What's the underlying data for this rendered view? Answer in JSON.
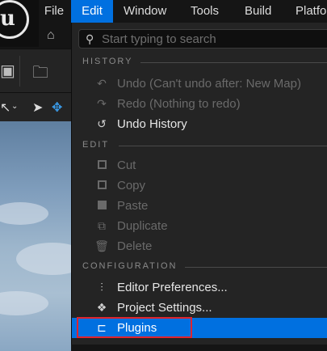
{
  "menubar": {
    "items": [
      {
        "label": "File"
      },
      {
        "label": "Edit"
      },
      {
        "label": "Window"
      },
      {
        "label": "Tools"
      },
      {
        "label": "Build"
      },
      {
        "label": "Platfo"
      }
    ],
    "active_index": 1
  },
  "icons": {
    "logo": "unreal-logo",
    "home": "home-icon",
    "save": "save-icon",
    "content": "folder-search-icon",
    "select": "select-arrow-icon",
    "move": "move-icon"
  },
  "colors": {
    "accent": "#0070e0",
    "highlight_box": "#e0242e",
    "menu_bg": "#242424"
  },
  "edit_menu": {
    "search": {
      "placeholder": "Start typing to search",
      "value": ""
    },
    "sections": [
      {
        "title": "HISTORY",
        "items": [
          {
            "label": "Undo (Can't undo after: New Map)",
            "icon": "undo-icon",
            "enabled": false
          },
          {
            "label": "Redo (Nothing to redo)",
            "icon": "redo-icon",
            "enabled": false
          },
          {
            "label": "Undo History",
            "icon": "history-icon",
            "enabled": true
          }
        ]
      },
      {
        "title": "EDIT",
        "items": [
          {
            "label": "Cut",
            "icon": "cut-icon",
            "enabled": false
          },
          {
            "label": "Copy",
            "icon": "copy-icon",
            "enabled": false
          },
          {
            "label": "Paste",
            "icon": "paste-icon",
            "enabled": false
          },
          {
            "label": "Duplicate",
            "icon": "duplicate-icon",
            "enabled": false
          },
          {
            "label": "Delete",
            "icon": "trash-icon",
            "enabled": false
          }
        ]
      },
      {
        "title": "CONFIGURATION",
        "items": [
          {
            "label": "Editor Preferences...",
            "icon": "sliders-icon",
            "enabled": true
          },
          {
            "label": "Project Settings...",
            "icon": "project-settings-icon",
            "enabled": true
          },
          {
            "label": "Plugins",
            "icon": "plugin-icon",
            "enabled": true,
            "selected": true
          }
        ]
      }
    ]
  }
}
